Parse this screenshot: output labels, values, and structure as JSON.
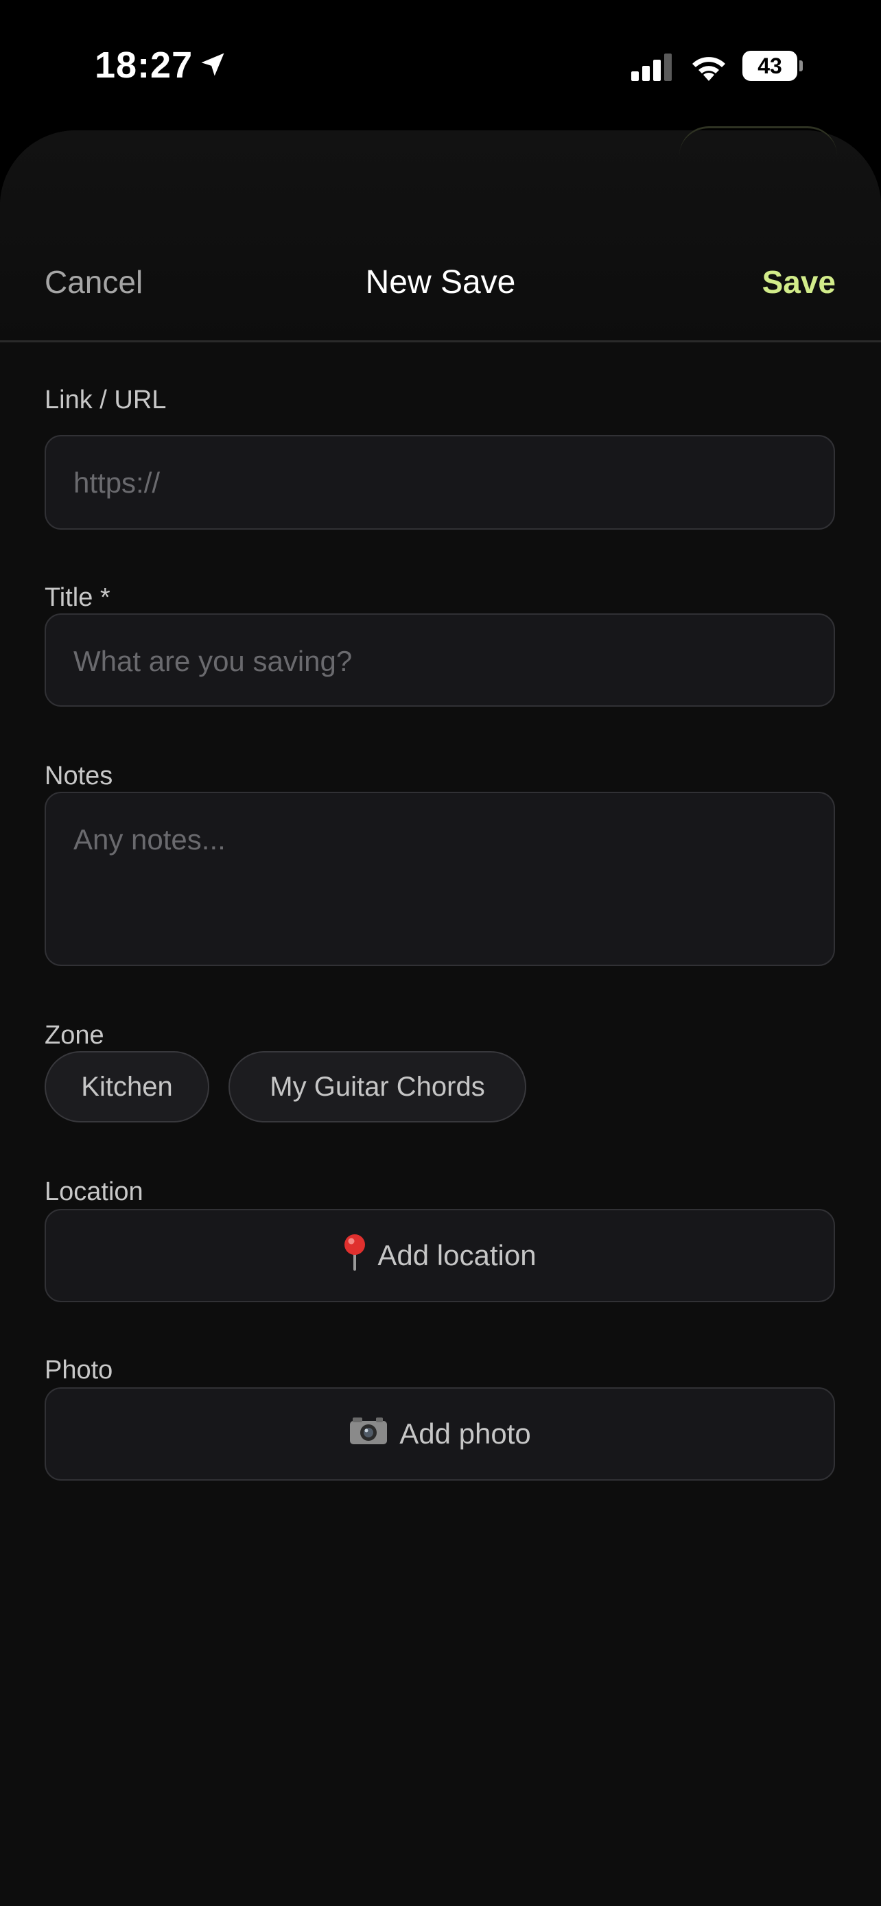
{
  "status_bar": {
    "time": "18:27",
    "battery": "43",
    "icons": [
      "location-arrow-icon",
      "cellular-signal-icon",
      "wifi-icon",
      "battery-icon"
    ]
  },
  "nav": {
    "cancel_label": "Cancel",
    "title": "New Save",
    "save_label": "Save"
  },
  "form": {
    "url": {
      "label": "Link / URL",
      "placeholder": "https://",
      "value": ""
    },
    "title": {
      "label": "Title *",
      "placeholder": "What are you saving?",
      "value": ""
    },
    "notes": {
      "label": "Notes",
      "placeholder": "Any notes...",
      "value": ""
    },
    "zone": {
      "label": "Zone",
      "options": [
        "Kitchen",
        "My Guitar Chords"
      ]
    },
    "location": {
      "label": "Location",
      "button_label": "Add location",
      "icon": "pin-icon"
    },
    "photo": {
      "label": "Photo",
      "button_label": "Add photo",
      "icon": "camera-icon"
    }
  },
  "colors": {
    "background": "#0d0d0d",
    "accent": "#d2ec8a",
    "field_bg": "#17171a",
    "field_border": "#313135"
  }
}
